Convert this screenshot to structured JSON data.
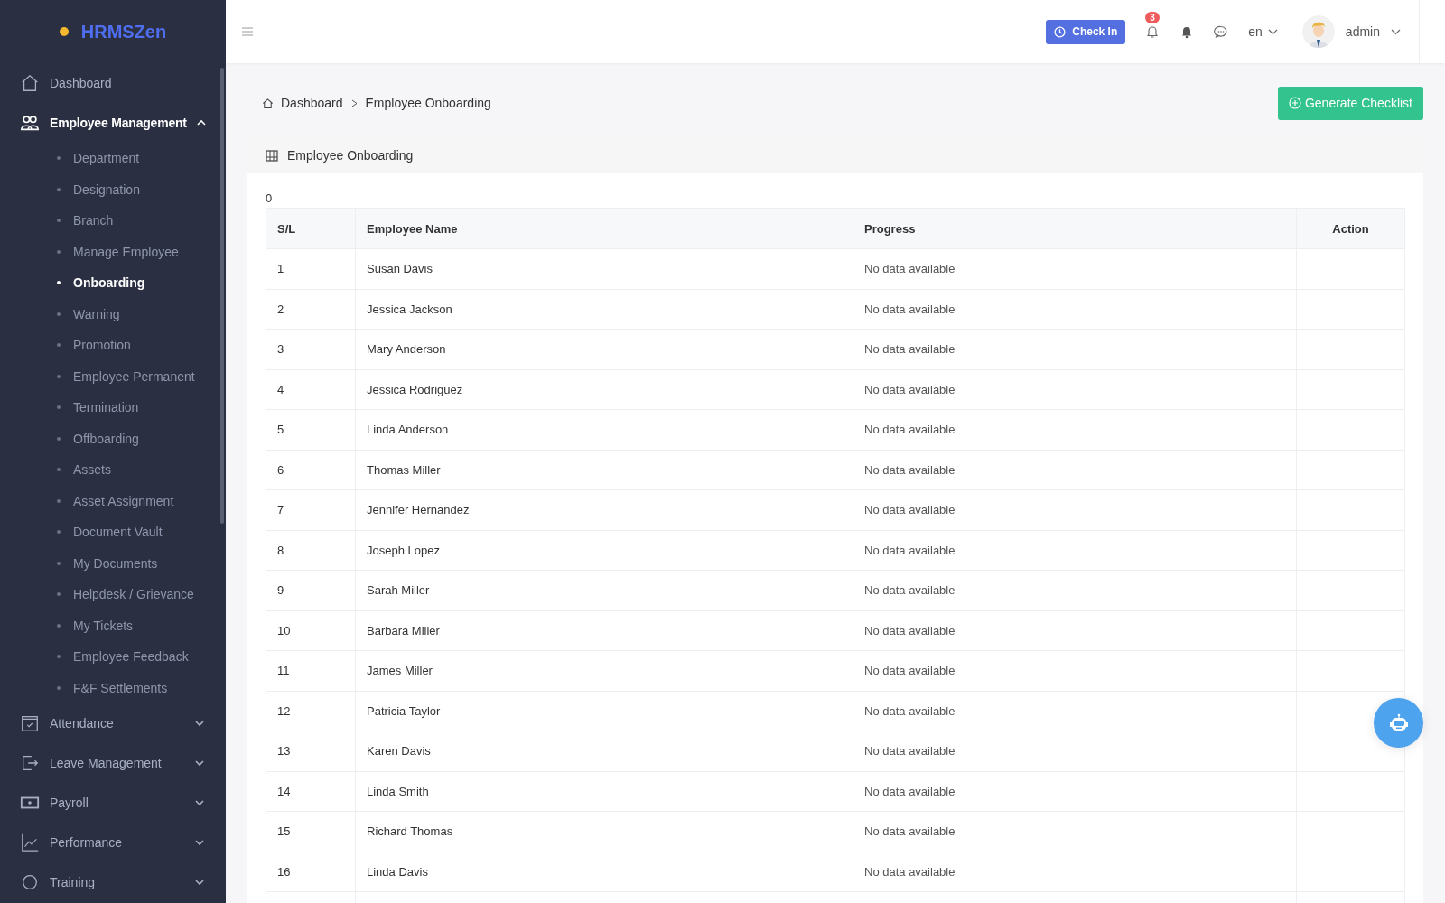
{
  "brand": {
    "name": "HRMSZen"
  },
  "sidebar": {
    "items": [
      {
        "label": "Dashboard",
        "kind": "home",
        "expanded": false
      },
      {
        "label": "Employee Management",
        "kind": "users",
        "expanded": true,
        "children": [
          {
            "label": "Department",
            "selected": false
          },
          {
            "label": "Designation",
            "selected": false
          },
          {
            "label": "Branch",
            "selected": false
          },
          {
            "label": "Manage Employee",
            "selected": false
          },
          {
            "label": "Onboarding",
            "selected": true
          },
          {
            "label": "Warning",
            "selected": false
          },
          {
            "label": "Promotion",
            "selected": false
          },
          {
            "label": "Employee Permanent",
            "selected": false
          },
          {
            "label": "Termination",
            "selected": false
          },
          {
            "label": "Offboarding",
            "selected": false
          },
          {
            "label": "Assets",
            "selected": false
          },
          {
            "label": "Asset Assignment",
            "selected": false
          },
          {
            "label": "Document Vault",
            "selected": false
          },
          {
            "label": "My Documents",
            "selected": false
          },
          {
            "label": "Helpdesk / Grievance",
            "selected": false
          },
          {
            "label": "My Tickets",
            "selected": false
          },
          {
            "label": "Employee Feedback",
            "selected": false
          },
          {
            "label": "F&F Settlements",
            "selected": false
          }
        ]
      },
      {
        "label": "Attendance",
        "kind": "calendar",
        "expanded": false
      },
      {
        "label": "Leave Management",
        "kind": "exit",
        "expanded": false
      },
      {
        "label": "Payroll",
        "kind": "money",
        "expanded": false
      },
      {
        "label": "Performance",
        "kind": "chart",
        "expanded": false
      },
      {
        "label": "Training",
        "kind": "circle",
        "expanded": false
      }
    ]
  },
  "topbar": {
    "check_in": "Check In",
    "notification_count": "3",
    "language": "en",
    "user": "admin"
  },
  "breadcrumb": [
    "Dashboard",
    "Employee Onboarding"
  ],
  "generate_button": "Generate Checklist",
  "card": {
    "title": "Employee Onboarding",
    "count": "0",
    "table": {
      "columns": [
        "S/L",
        "Employee Name",
        "Progress",
        "Action"
      ],
      "rows": [
        [
          "1",
          "Susan Davis",
          "No data available"
        ],
        [
          "2",
          "Jessica Jackson",
          "No data available"
        ],
        [
          "3",
          "Mary Anderson",
          "No data available"
        ],
        [
          "4",
          "Jessica Rodriguez",
          "No data available"
        ],
        [
          "5",
          "Linda Anderson",
          "No data available"
        ],
        [
          "6",
          "Thomas Miller",
          "No data available"
        ],
        [
          "7",
          "Jennifer Hernandez",
          "No data available"
        ],
        [
          "8",
          "Joseph Lopez",
          "No data available"
        ],
        [
          "9",
          "Sarah Miller",
          "No data available"
        ],
        [
          "10",
          "Barbara Miller",
          "No data available"
        ],
        [
          "11",
          "James Miller",
          "No data available"
        ],
        [
          "12",
          "Patricia Taylor",
          "No data available"
        ],
        [
          "13",
          "Karen Davis",
          "No data available"
        ],
        [
          "14",
          "Linda Smith",
          "No data available"
        ],
        [
          "15",
          "Richard Thomas",
          "No data available"
        ],
        [
          "16",
          "Linda Davis",
          "No data available"
        ]
      ]
    }
  }
}
